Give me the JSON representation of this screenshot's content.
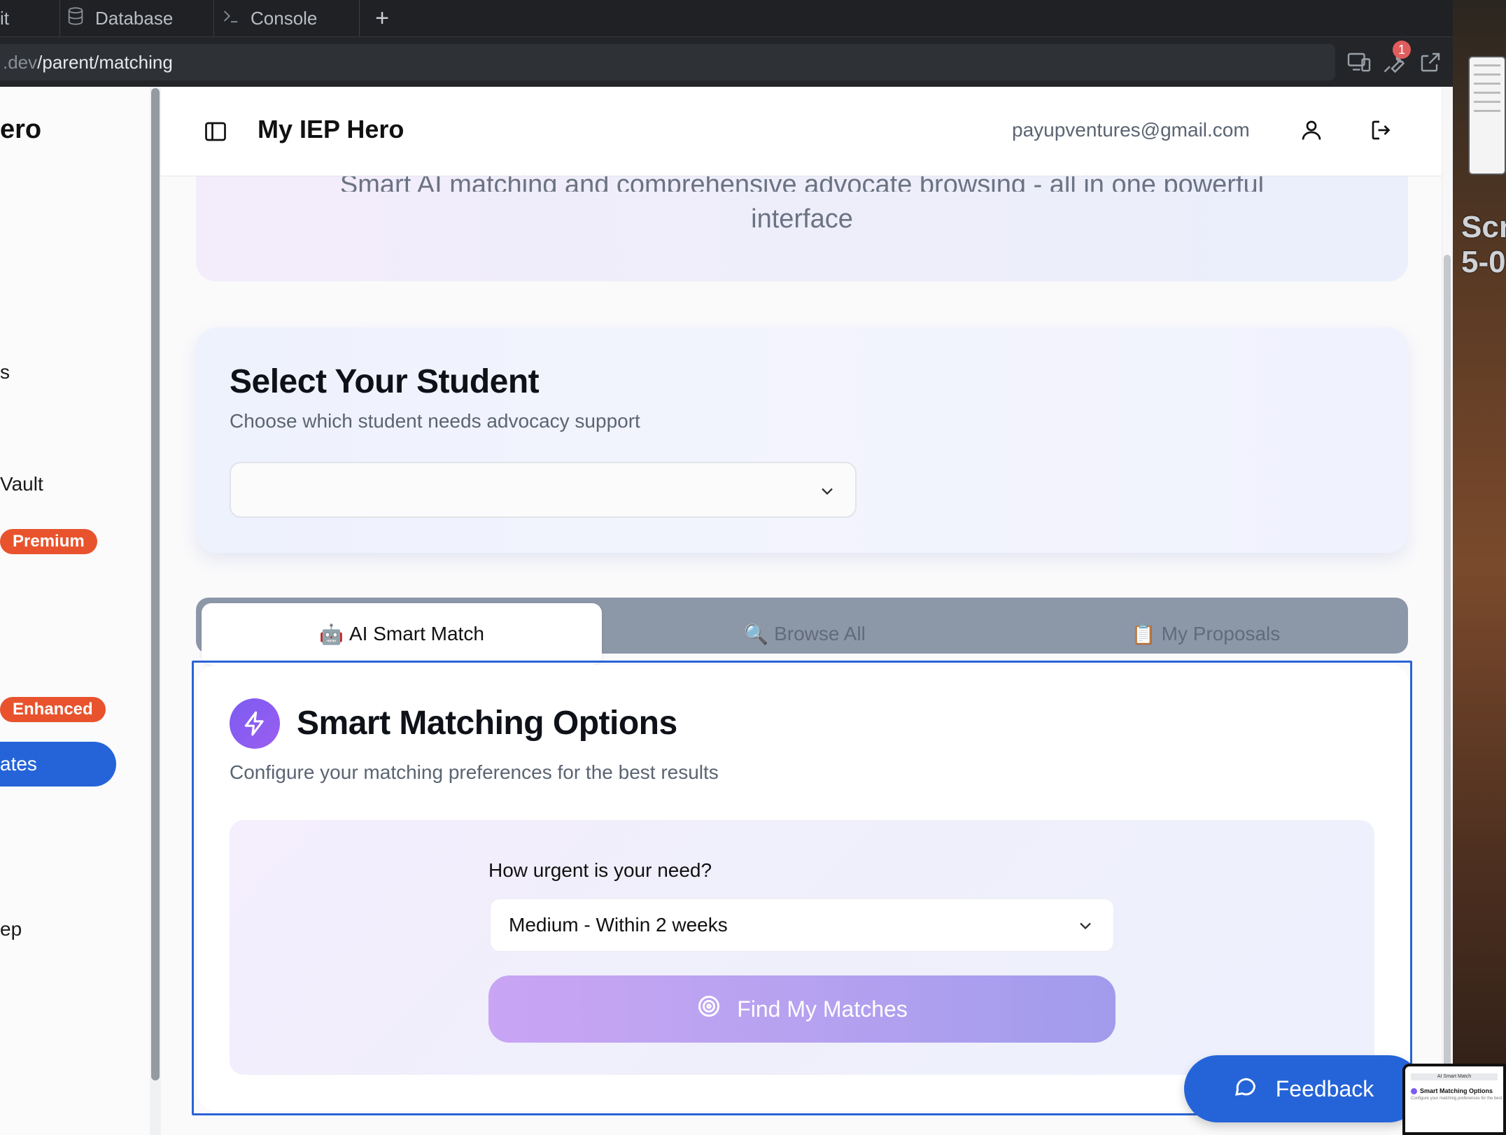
{
  "browser": {
    "tabs": [
      {
        "label": "it"
      },
      {
        "label": "Database",
        "icon": "database-icon"
      },
      {
        "label": "Console",
        "icon": "terminal-icon"
      }
    ],
    "new_tab": "+",
    "url_prefix": ".dev",
    "url_path": "/parent/matching",
    "notification_count": "1"
  },
  "desktop": {
    "screenshot_label_line1": "Scre",
    "screenshot_label_line2": "5-0"
  },
  "sidebar": {
    "brand": "ero",
    "items": [
      {
        "label": "s"
      },
      {
        "label": "Vault"
      },
      {
        "label": "ates"
      },
      {
        "label": "ep"
      }
    ],
    "badges": [
      {
        "label": "Premium"
      },
      {
        "label": "Enhanced"
      }
    ]
  },
  "topbar": {
    "title": "My IEP Hero",
    "email": "payupventures@gmail.com"
  },
  "hero": {
    "subtitle_line1": "Smart AI matching and comprehensive advocate browsing - all in one powerful",
    "subtitle_line2": "interface"
  },
  "student": {
    "heading": "Select Your Student",
    "subheading": "Choose which student needs advocacy support",
    "selected": ""
  },
  "tabs": [
    {
      "emoji": "🤖",
      "label": "AI Smart Match",
      "active": true
    },
    {
      "emoji": "🔍",
      "label": "Browse All",
      "active": false
    },
    {
      "emoji": "📋",
      "label": "My Proposals",
      "active": false
    }
  ],
  "matching": {
    "title": "Smart Matching Options",
    "subtitle": "Configure your matching preferences for the best results",
    "urgency_label": "How urgent is your need?",
    "urgency_value": "Medium - Within 2 weeks",
    "find_button": "Find My Matches"
  },
  "feedback": {
    "label": "Feedback"
  },
  "preview": {
    "tab": "AI Smart Match",
    "title": "Smart Matching Options",
    "subtitle": "Configure your matching preferences for the best results"
  },
  "colors": {
    "accent_blue": "#2564d8",
    "badge_orange": "#e8532d",
    "purple": "#7d5bf2"
  }
}
